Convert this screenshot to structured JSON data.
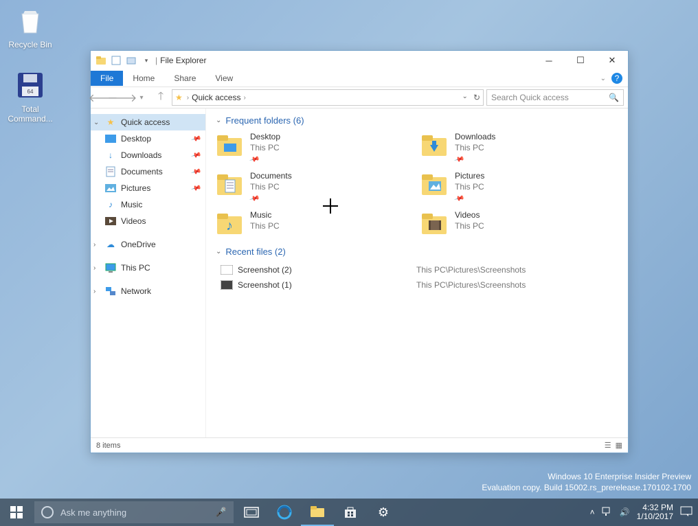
{
  "desktop": {
    "icons": [
      {
        "label": "Recycle Bin"
      },
      {
        "label": "Total Command..."
      }
    ],
    "watermark_line1": "Windows 10 Enterprise Insider Preview",
    "watermark_line2": "Evaluation copy. Build 15002.rs_prerelease.170102-1700"
  },
  "explorer": {
    "title": "File Explorer",
    "tabs": {
      "file": "File",
      "home": "Home",
      "share": "Share",
      "view": "View"
    },
    "breadcrumb": {
      "root": "Quick access"
    },
    "search_placeholder": "Search Quick access",
    "nav": {
      "quick_access": "Quick access",
      "pinned": [
        {
          "label": "Desktop"
        },
        {
          "label": "Downloads"
        },
        {
          "label": "Documents"
        },
        {
          "label": "Pictures"
        }
      ],
      "music": "Music",
      "videos": "Videos",
      "onedrive": "OneDrive",
      "thispc": "This PC",
      "network": "Network"
    },
    "groups": {
      "frequent_label": "Frequent folders (6)",
      "recent_label": "Recent files (2)"
    },
    "frequent": [
      {
        "name": "Desktop",
        "sub": "This PC",
        "pinned": true
      },
      {
        "name": "Downloads",
        "sub": "This PC",
        "pinned": true
      },
      {
        "name": "Documents",
        "sub": "This PC",
        "pinned": true
      },
      {
        "name": "Pictures",
        "sub": "This PC",
        "pinned": true
      },
      {
        "name": "Music",
        "sub": "This PC",
        "pinned": false
      },
      {
        "name": "Videos",
        "sub": "This PC",
        "pinned": false
      }
    ],
    "recent": [
      {
        "name": "Screenshot (2)",
        "loc": "This PC\\Pictures\\Screenshots"
      },
      {
        "name": "Screenshot (1)",
        "loc": "This PC\\Pictures\\Screenshots"
      }
    ],
    "status": "8 items"
  },
  "taskbar": {
    "cortana_placeholder": "Ask me anything",
    "time": "4:32 PM",
    "date": "1/10/2017"
  }
}
